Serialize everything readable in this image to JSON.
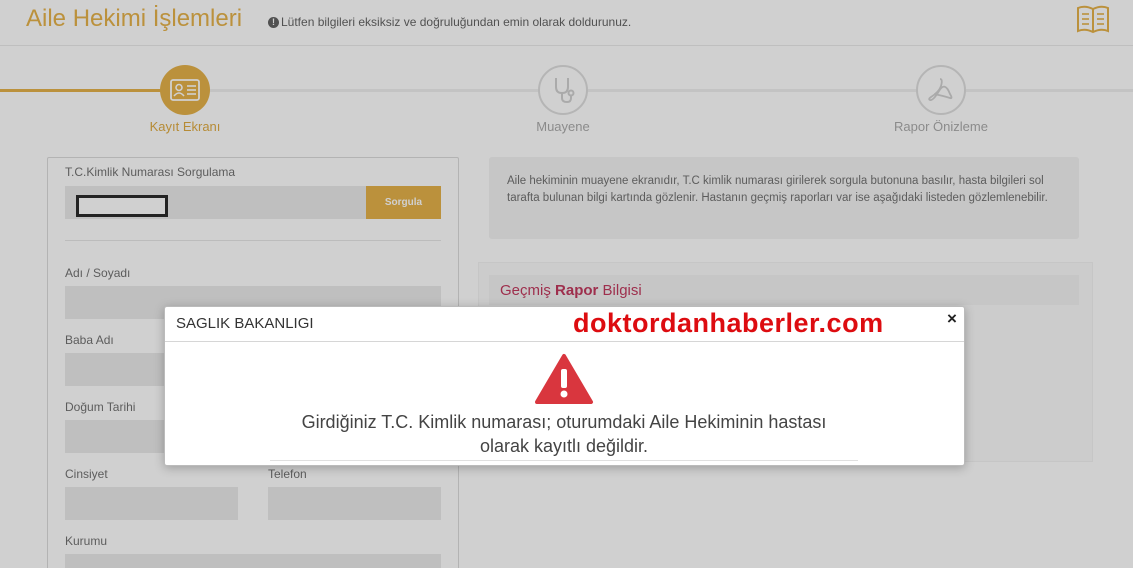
{
  "header": {
    "title": "Aile Hekimi İşlemleri",
    "hint": "Lütfen bilgileri eksiksiz ve doğruluğundan emin olarak doldurunuz."
  },
  "stepper": {
    "steps": [
      {
        "label": "Kayıt Ekranı",
        "state": "active",
        "icon": "id-card-icon"
      },
      {
        "label": "Muayene",
        "state": "idle",
        "icon": "stethoscope-icon"
      },
      {
        "label": "Rapor Önizleme",
        "state": "idle",
        "icon": "pdf-icon"
      }
    ]
  },
  "form": {
    "tc_label": "T.C.Kimlik Numarası Sorgulama",
    "tc_value": "",
    "query_button": "Sorgula",
    "name_label": "Adı / Soyadı",
    "father_label": "Baba Adı",
    "birth_label": "Doğum Tarihi",
    "gender_label": "Cinsiyet",
    "phone_label": "Telefon",
    "institution_label": "Kurumu"
  },
  "info": {
    "text": "Aile hekiminin muayene ekranıdır, T.C kimlik numarası girilerek sorgula butonuna basılır, hasta bilgileri sol tarafta bulunan bilgi kartında gözlenir. Hastanın geçmiş raporları var ise aşağıdaki listeden gözlemlenebilir."
  },
  "report": {
    "title_prefix": "Geçmiş ",
    "title_bold": "Rapor",
    "title_suffix": " Bilgisi"
  },
  "modal": {
    "title": "SAGLIK BAKANLIGI",
    "watermark": "doktordanhaberler.com",
    "close": "×",
    "message_line1": "Girdiğiniz T.C. Kimlik numarası; oturumdaki Aile Hekiminin hastası",
    "message_line2": "olarak kayıtlı değildir."
  },
  "colors": {
    "accent": "#e0a225",
    "report_title": "#b5123e",
    "warning": "#d9363e",
    "watermark": "#dd0c10"
  }
}
